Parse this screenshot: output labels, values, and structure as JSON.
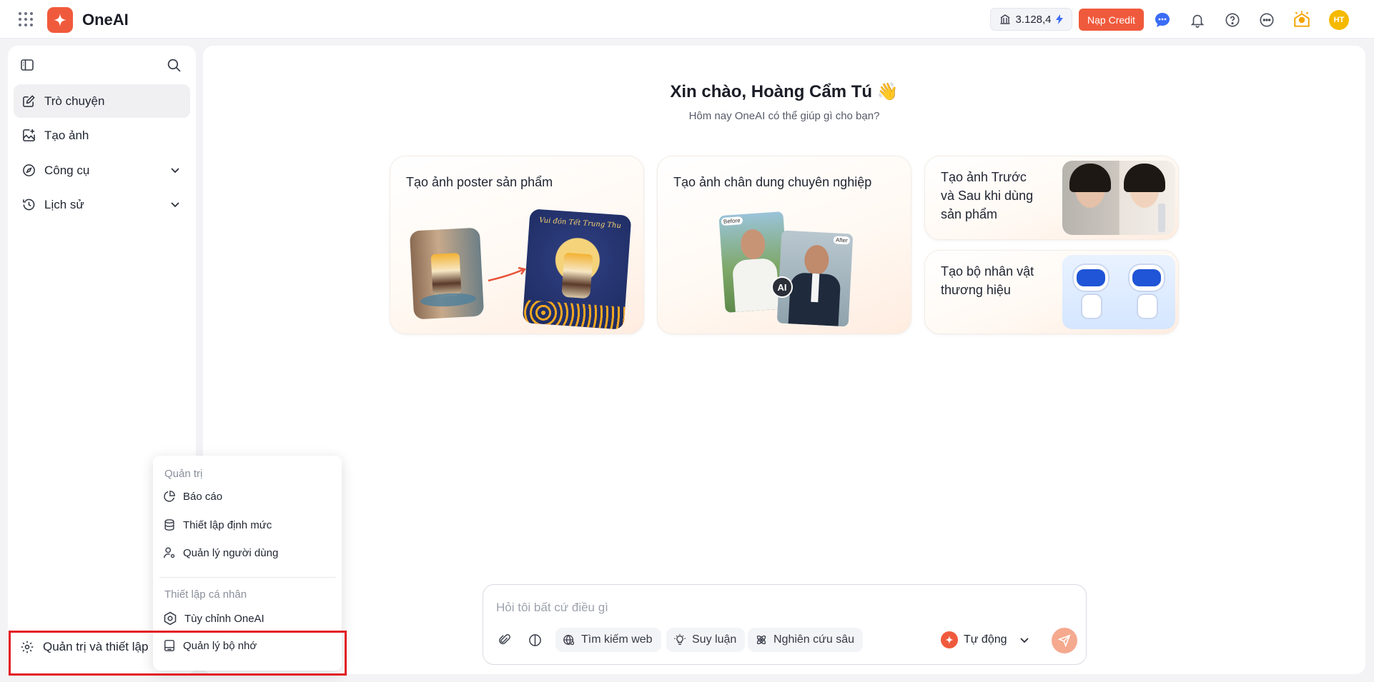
{
  "app": {
    "name": "OneAI"
  },
  "topbar": {
    "credit_value": "3.128,4",
    "nap_credit_label": "Nạp Credit",
    "avatar_initials": "HT",
    "accent_color": "#f05a3c"
  },
  "sidebar": {
    "items": [
      {
        "label": "Trò chuyện",
        "icon": "edit-icon",
        "active": true
      },
      {
        "label": "Tạo ảnh",
        "icon": "image-plus-icon"
      },
      {
        "label": "Công cụ",
        "icon": "compass-icon",
        "expandable": true
      },
      {
        "label": "Lịch sử",
        "icon": "history-icon",
        "expandable": true
      }
    ],
    "settings_label": "Quản trị và thiết lập"
  },
  "main": {
    "greeting": "Xin chào, Hoàng Cẩm Tú 👋",
    "subtitle": "Hôm nay OneAI có thể giúp gì cho bạn?",
    "cards": [
      {
        "title": "Tạo ảnh poster sản phẩm",
        "poster_text": "Vui đón Tết Trung Thu"
      },
      {
        "title": "Tạo ảnh chân dung chuyên nghiệp",
        "before_label": "Before",
        "after_label": "After",
        "ai_badge": "AI"
      },
      {
        "title": "Tạo ảnh Trước và Sau khi dùng sản phẩm"
      },
      {
        "title": "Tạo bộ nhân vật thương hiệu"
      }
    ]
  },
  "chat": {
    "placeholder": "Hỏi tôi bất cứ điều gì",
    "chips": [
      "Tìm kiếm web",
      "Suy luận",
      "Nghiên cứu sâu"
    ],
    "model_label": "Tự động"
  },
  "menu": {
    "admin_header": "Quản trị",
    "admin_items": [
      {
        "label": "Báo cáo",
        "icon": "pie-chart-icon"
      },
      {
        "label": "Thiết lập định mức",
        "icon": "database-icon"
      },
      {
        "label": "Quản lý người dùng",
        "icon": "user-settings-icon"
      }
    ],
    "personal_header": "Thiết lập cá nhân",
    "personal_items": [
      {
        "label": "Tùy chỉnh OneAI",
        "icon": "hexagon-settings-icon"
      },
      {
        "label": "Quản lý bộ nhớ",
        "icon": "memory-icon"
      }
    ]
  }
}
